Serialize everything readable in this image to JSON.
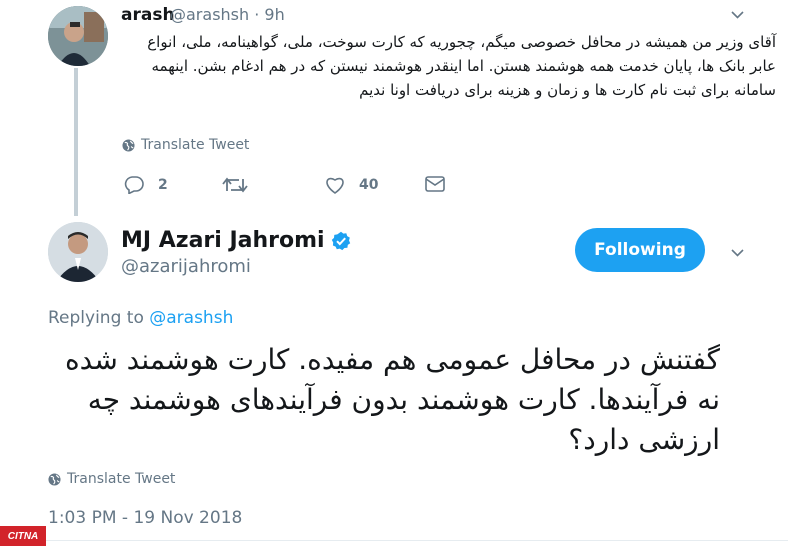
{
  "reply_tweet": {
    "author_name": "arash",
    "author_handle": "@arashsh",
    "time_ago": "9h",
    "text": "آقای وزیر من همیشه در محافل خصوصی میگم، چجوریه که کارت سوخت، ملی، گواهینامه، ملی، انواع عابر بانک ها، پایان خدمت همه هوشمند هستن. اما اینقدر هوشمند نیستن که در هم ادغام بشن. اینهمه سامانه برای ثبت نام کارت ها و زمان و هزینه برای دریافت اونا ندیم",
    "translate_label": "Translate Tweet",
    "reply_count": "2",
    "retweet_count": "",
    "like_count": "40"
  },
  "main_tweet": {
    "author_name": "MJ Azari Jahromi",
    "author_handle": "@azarijahromi",
    "follow_label": "Following",
    "replying_prefix": "Replying to",
    "replying_handle": "@arashsh",
    "text": "گفتنش در محافل عمومی هم مفیده. کارت هوشمند شده نه فرآیندها. کارت هوشمند بدون فرآیندهای هوشمند چه ارزشی دارد؟",
    "translate_label": "Translate Tweet",
    "timestamp": "1:03 PM - 19 Nov 2018"
  },
  "watermark": {
    "text": "CITNA",
    "color": "#d2232a"
  },
  "colors": {
    "accent": "#1da1f2",
    "muted": "#657786",
    "verified": "#1da1f2"
  }
}
